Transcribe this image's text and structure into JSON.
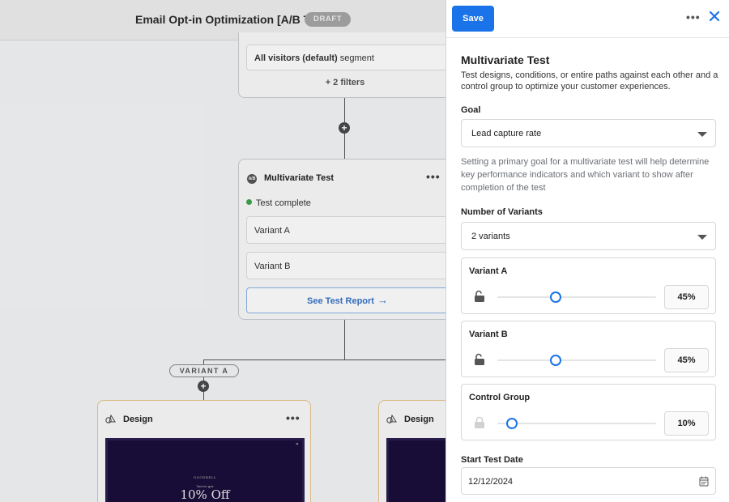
{
  "canvas": {
    "title": "Email Opt-in Optimization [A/B Test]",
    "status_badge": "DRAFT",
    "segment": {
      "name": "All visitors (default)",
      "suffix": "segment",
      "filters": "+ 2 filters"
    },
    "multivariate_card": {
      "title": "Multivariate Test",
      "status": "Test complete",
      "variants": [
        "Variant A",
        "Variant B"
      ],
      "report_button": "See Test Report"
    },
    "branch_label": "VARIANT A",
    "design_cards": [
      {
        "label": "Design",
        "preview_brand": "GOODBELL",
        "preview_small": "You've got",
        "preview_offer": "10% Off"
      },
      {
        "label": "Design"
      }
    ]
  },
  "panel": {
    "save_label": "Save",
    "title": "Multivariate Test",
    "description": "Test designs, conditions, or entire paths against each other and a control group to optimize your customer experiences.",
    "goal": {
      "label": "Goal",
      "value": "Lead capture rate",
      "hint": "Setting a primary goal for a multivariate test will help determine key performance indicators and which variant to show after completion of the test"
    },
    "variants_count": {
      "label": "Number of Variants",
      "value": "2 variants"
    },
    "allocations": [
      {
        "name": "Variant A",
        "percent": 45,
        "display": "45%",
        "locked": false
      },
      {
        "name": "Variant B",
        "percent": 45,
        "display": "45%",
        "locked": false
      },
      {
        "name": "Control Group",
        "percent": 10,
        "display": "10%",
        "locked": true
      }
    ],
    "start_date": {
      "label": "Start Test Date",
      "value": "12/12/2024"
    }
  },
  "colors": {
    "primary": "#1a73e8",
    "success": "#3fa34d",
    "design_border": "#e7c48e",
    "preview_bg": "#1a0e3a"
  }
}
